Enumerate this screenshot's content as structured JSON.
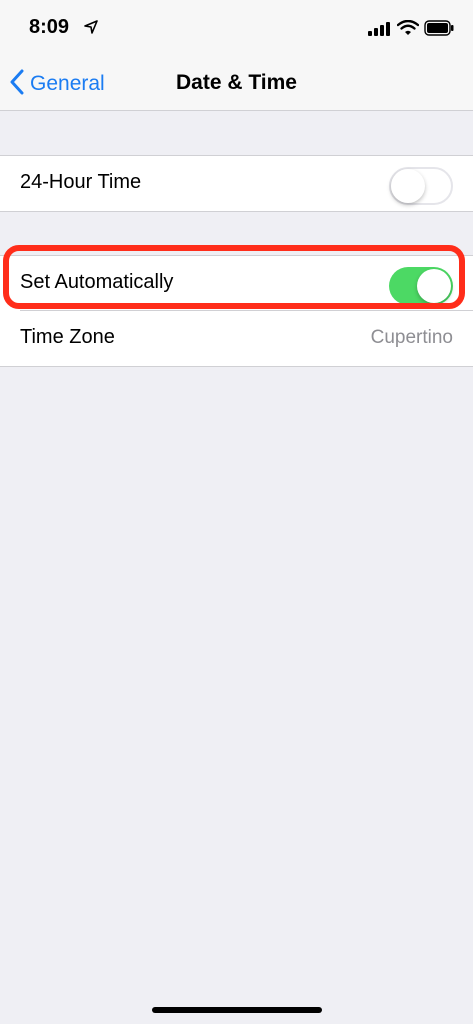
{
  "status_bar": {
    "time": "8:09",
    "icons": [
      "location-arrow-icon",
      "cellular-signal-icon",
      "wifi-icon",
      "battery-icon"
    ]
  },
  "nav": {
    "back_label": "General",
    "title": "Date & Time"
  },
  "groups": [
    {
      "rows": [
        {
          "label": "24-Hour Time",
          "toggle": "off"
        }
      ]
    },
    {
      "rows": [
        {
          "label": "Set Automatically",
          "toggle": "on",
          "highlighted": true
        },
        {
          "label": "Time Zone",
          "value": "Cupertino"
        }
      ]
    }
  ],
  "colors": {
    "accent": "#1b7cf2",
    "toggle_on": "#4cd964",
    "highlight": "#ff2d1a",
    "background": "#efeff4"
  }
}
